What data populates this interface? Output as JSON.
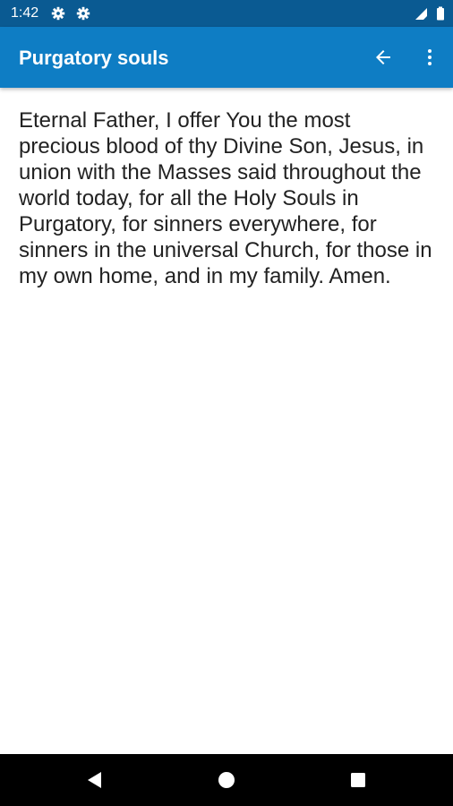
{
  "status_bar": {
    "time": "1:42",
    "left_icons": [
      "settings-gear-icon",
      "settings-gear-icon"
    ],
    "right_icons": [
      "signal-icon",
      "battery-icon"
    ],
    "color": "#0a5a92"
  },
  "app_bar": {
    "title": "Purgatory souls",
    "actions": [
      "back-arrow-icon",
      "more-vert-icon"
    ],
    "color": "#0e7dc4"
  },
  "content": {
    "prayer_text": "Eternal Father, I offer You the most precious blood of thy Divine Son, Jesus, in union with the Masses said throughout the world today, for all the Holy Souls in Purgatory, for sinners everywhere, for sinners in the universal Church, for those in my own home, and in my family. Amen."
  },
  "nav_bar": {
    "buttons": [
      "back-triangle-icon",
      "home-circle-icon",
      "recents-square-icon"
    ]
  }
}
